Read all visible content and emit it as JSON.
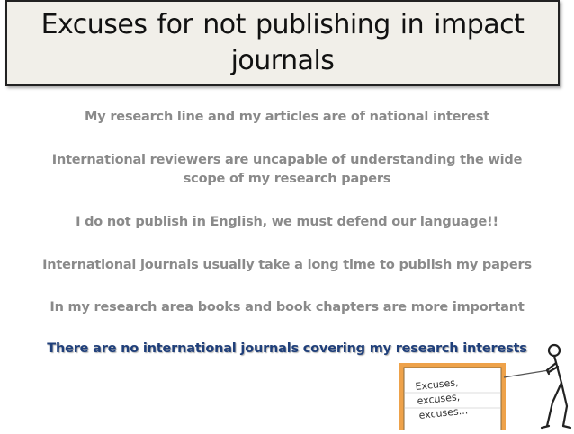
{
  "slide": {
    "title_line1": "Excuses for not publishing in impact",
    "title_line2": "journals",
    "excuses": [
      "My research line and my articles are of national interest",
      "International reviewers are uncapable of understanding the wide",
      "scope of my research papers",
      "I do not publish in English, we must defend our language!!",
      "International journals usually take a long time to publish my papers",
      "In my research area books and book chapters are more important",
      "There are no international journals covering my research interests"
    ],
    "sign_text": [
      "Excuses,",
      "excuses,",
      "excuses..."
    ],
    "colors": {
      "title_bg": "#f1efe9",
      "body_text": "#8a8a8a",
      "highlight_text": "#1f3f7a",
      "sign_board": "#f0a24a"
    }
  }
}
